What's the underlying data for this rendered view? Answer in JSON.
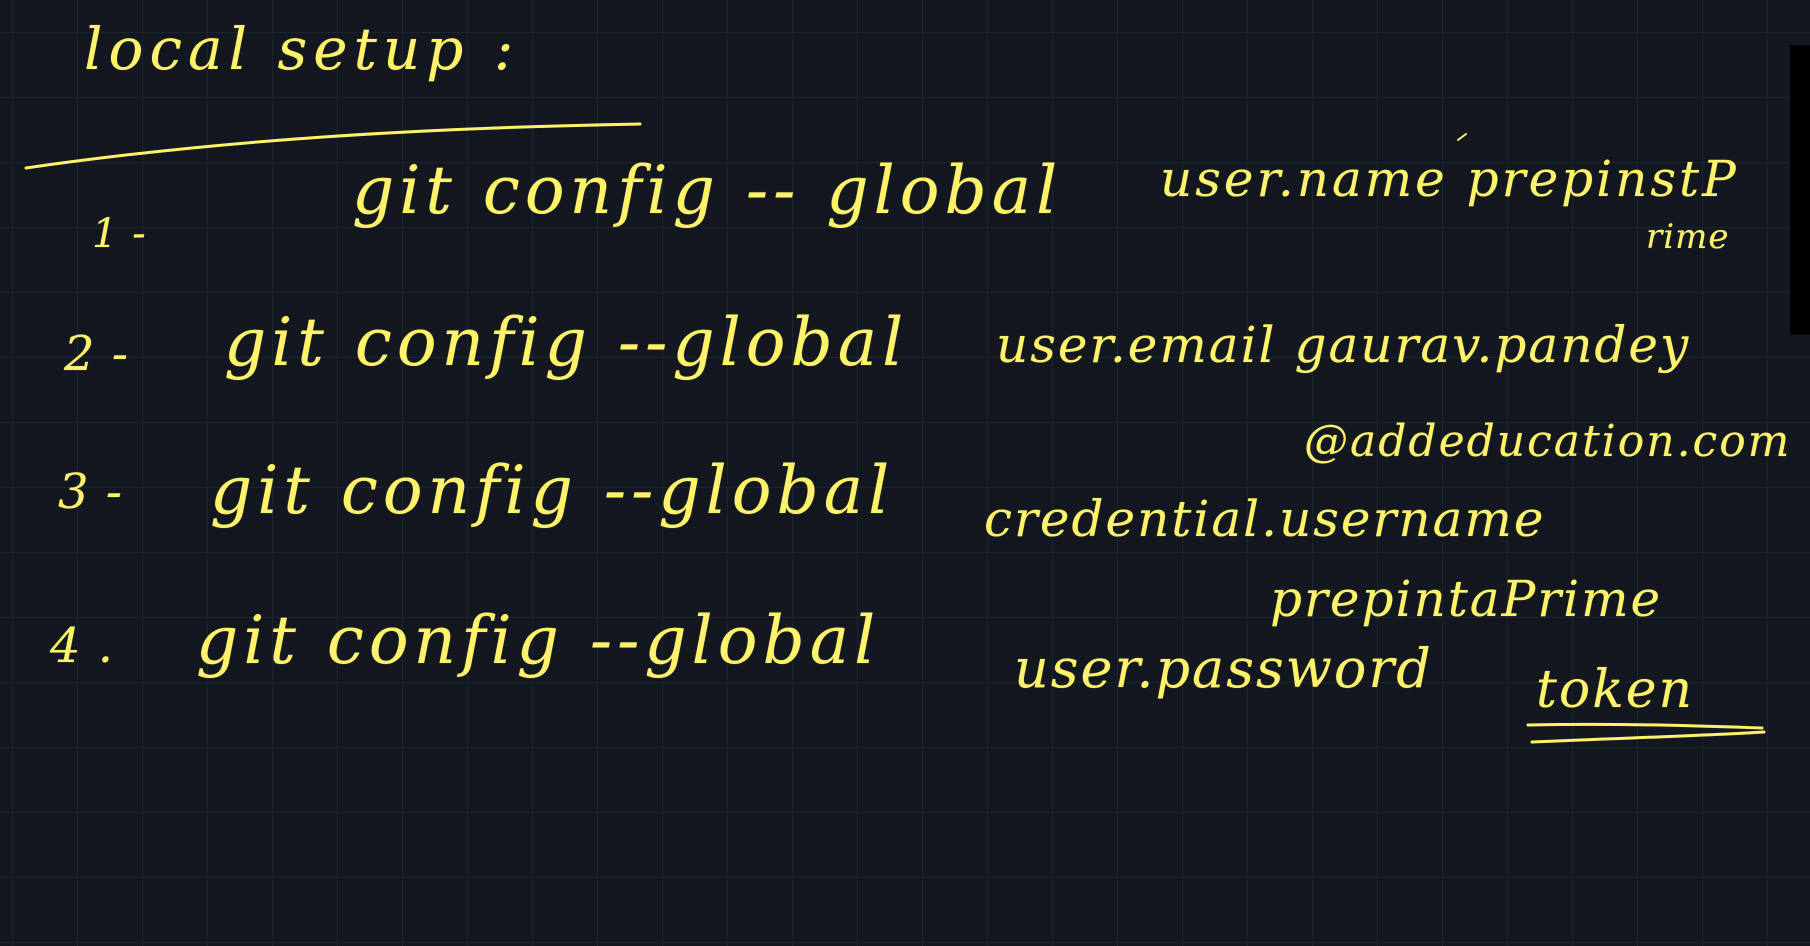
{
  "board": {
    "title": "local setup :",
    "lines": [
      {
        "number": "1 -",
        "command": "git config -- global",
        "value": "user.name prepinstaprime"
      },
      {
        "number": "2 -",
        "command": "git config --global",
        "value": "user.email gaurav.pandey@addeducation.com"
      },
      {
        "number": "3 -",
        "command": "git config --global",
        "value": "credential.username prepinstaprime"
      },
      {
        "number": "4 .",
        "command": "git config --global",
        "value": "user.password token"
      }
    ]
  },
  "display": {
    "title": "local setup :",
    "line1": {
      "number": "1 -",
      "command": "git config -- global",
      "value_a": "user.name prepinstP",
      "value_b": "rime"
    },
    "line2": {
      "number": "2 -",
      "command": "git config --global",
      "value_a": "user.email gaurav.pandey",
      "value_b": "@addeducation.com"
    },
    "line3": {
      "number": "3 -",
      "command": "git config --global",
      "value_a": "credential.username",
      "value_b": "prepintaPrime"
    },
    "line4": {
      "number": "4 .",
      "command": "git config --global",
      "value_a": "user.password",
      "value_b": "token"
    }
  },
  "colors": {
    "background": "#121720",
    "grid": "#1d2330",
    "ink": "#fff36b"
  }
}
